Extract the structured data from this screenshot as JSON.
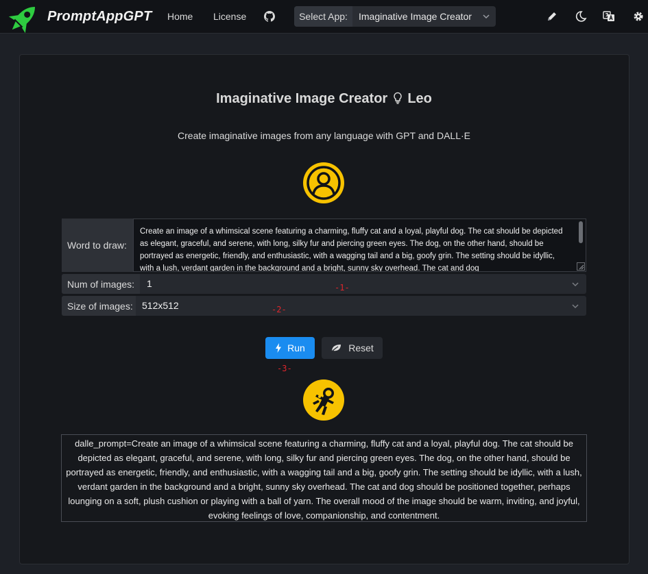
{
  "header": {
    "brand": "PromptAppGPT",
    "nav": [
      {
        "label": "Home"
      },
      {
        "label": "License"
      }
    ],
    "select_app": {
      "label": "Select App:",
      "value": "Imaginative Image Creator"
    },
    "icons": [
      "rocket-logo-icon",
      "github-icon",
      "chevron-down-icon",
      "pencil-icon",
      "moon-icon",
      "translate-icon",
      "gear-icon"
    ]
  },
  "colors": {
    "accent": "#1a8cf0",
    "avatar_yellow": "#f7c200",
    "logo_green": "#2ecc40",
    "marker_red": "#e0262c"
  },
  "main": {
    "title_prefix": "Imaginative Image Creator",
    "title_suffix": "Leo",
    "subtitle": "Create imaginative images from any language with GPT and DALL·E",
    "word_label": "Word to draw:",
    "word_value": "Create an image of a whimsical scene featuring a charming, fluffy cat and a loyal, playful dog. The cat should be depicted as elegant, graceful, and serene, with long, silky fur and piercing green eyes. The dog, on the other hand, should be portrayed as energetic, friendly, and enthusiastic, with a wagging tail and a big, goofy grin. The setting should be idyllic, with a lush, verdant garden in the background and a bright, sunny sky overhead. The cat and dog",
    "num_label": "Num of images:",
    "num_value": "1",
    "size_label": "Size of images:",
    "size_value": "512x512",
    "markers": [
      "-1-",
      "-2-",
      "-3-"
    ],
    "run_label": "Run",
    "reset_label": "Reset",
    "output": "dalle_prompt=Create an image of a whimsical scene featuring a charming, fluffy cat and a loyal, playful dog. The cat should be depicted as elegant, graceful, and serene, with long, silky fur and piercing green eyes. The dog, on the other hand, should be portrayed as energetic, friendly, and enthusiastic, with a wagging tail and a big, goofy grin. The setting should be idyllic, with a lush, verdant garden in the background and a bright, sunny sky overhead. The cat and dog should be positioned together, perhaps lounging on a soft, plush cushion or playing with a ball of yarn. The overall mood of the image should be warm, inviting, and joyful, evoking feelings of love, companionship, and contentment."
  }
}
